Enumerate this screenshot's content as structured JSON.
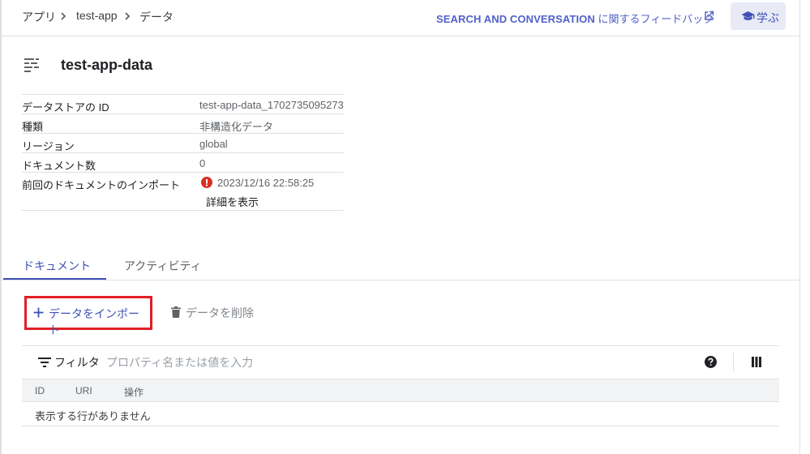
{
  "breadcrumb": {
    "items": [
      "アプリ",
      "test-app",
      "データ"
    ]
  },
  "feedback": {
    "bold": "SEARCH AND CONVERSATION",
    "rest": " に関するフィードバック"
  },
  "learn": {
    "label": "学ぶ"
  },
  "datastore": {
    "title": "test-app-data",
    "rows": [
      {
        "key": "データストアの ID",
        "value": "test-app-data_1702735095273"
      },
      {
        "key": "種類",
        "value": "非構造化データ"
      },
      {
        "key": "リージョン",
        "value": "global"
      },
      {
        "key": "ドキュメント数",
        "value": "0"
      },
      {
        "key": "前回のドキュメントのインポート",
        "value": "2023/12/16 22:58:25",
        "link": "詳細を表示"
      }
    ]
  },
  "tabs": [
    {
      "label": "ドキュメント",
      "active": true
    },
    {
      "label": "アクティビティ",
      "active": false
    }
  ],
  "actions": {
    "import": "データをインポート",
    "delete": "データを削除"
  },
  "table": {
    "filter_label": "フィルタ",
    "filter_placeholder": "プロパティ名または値を入力",
    "columns": [
      "ID",
      "URI",
      "操作"
    ],
    "empty": "表示する行がありません"
  },
  "colors": {
    "accent": "#3f51b5",
    "highlight": "#e31e26",
    "error": "#d93025"
  },
  "icons": [
    "chevron-right-icon",
    "external-link-icon",
    "school-icon",
    "datastore-icon",
    "error-icon",
    "plus-icon",
    "trash-icon",
    "filter-icon",
    "help-icon",
    "columns-icon"
  ]
}
